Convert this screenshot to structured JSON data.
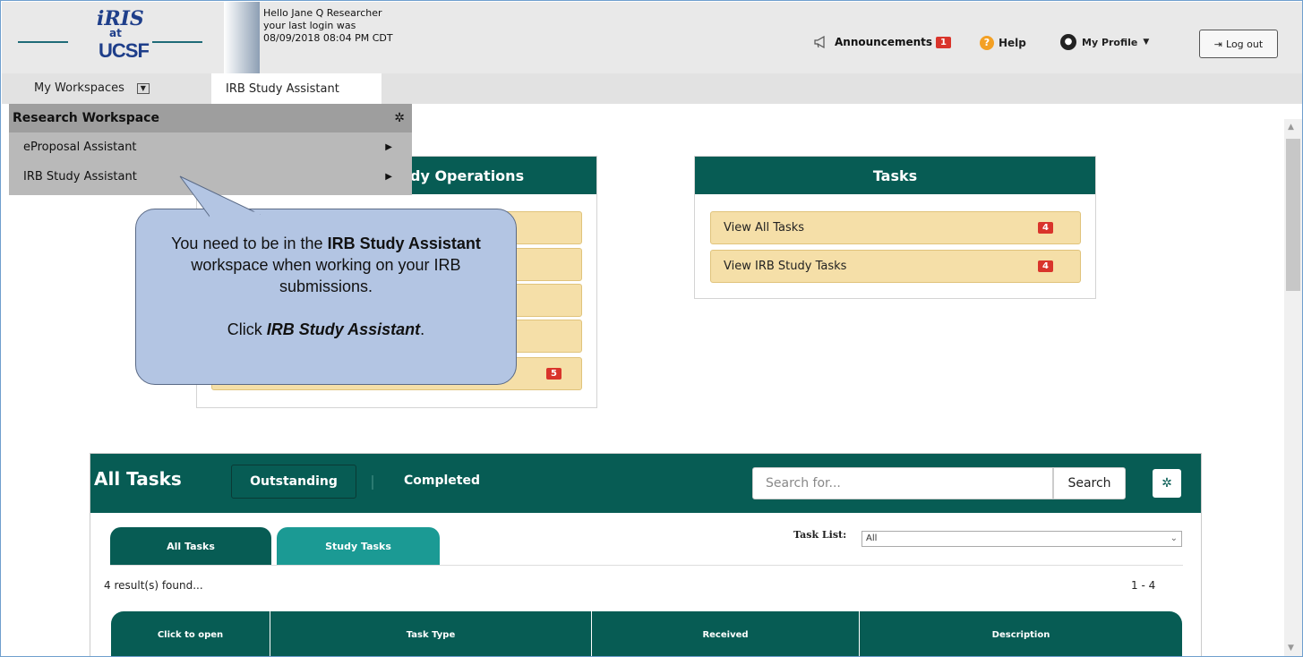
{
  "header": {
    "logo": {
      "iris": "iRIS",
      "at": "at",
      "ucsf": "UCSF"
    },
    "greeting": [
      "Hello Jane Q Researcher",
      "your last login was",
      "08/09/2018 08:04 PM CDT"
    ],
    "announcements_label": "Announcements",
    "announcements_count": "1",
    "help_label": "Help",
    "profile_label": "My Profile",
    "logout_label": "Log out"
  },
  "nav": {
    "workspaces_label": "My Workspaces",
    "active_tab": "IRB Study Assistant"
  },
  "dropdown": {
    "title": "Research Workspace",
    "items": [
      {
        "label": "eProposal Assistant"
      },
      {
        "label": "IRB Study Assistant"
      }
    ]
  },
  "study_operations": {
    "title_visible": "dy Operations",
    "badge": "5"
  },
  "tasks_panel": {
    "title": "Tasks",
    "rows": [
      {
        "label": "View All Tasks",
        "count": "4"
      },
      {
        "label": "View IRB Study Tasks",
        "count": "4"
      }
    ]
  },
  "callout": {
    "line1_pre": "You need to be in the ",
    "line1_bold": "IRB Study Assistant",
    "line1_post": " workspace when working on your IRB submissions.",
    "line2_pre": "Click ",
    "line2_bold": "IRB Study Assistant",
    "line2_post": "."
  },
  "all_tasks": {
    "title": "All Tasks",
    "outstanding_label": "Outstanding",
    "completed_label": "Completed",
    "search_placeholder": "Search for...",
    "search_button": "Search",
    "tabs": [
      "All Tasks",
      "Study Tasks"
    ],
    "task_list_label": "Task List:",
    "task_list_value": "All",
    "results_text": "4 result(s) found...",
    "paging_text": "1 - 4",
    "columns": [
      "Click to open",
      "Task Type",
      "Received",
      "Description"
    ]
  },
  "colors": {
    "brand_teal": "#075c54",
    "tab_teal_light": "#1b9a94",
    "row_yellow": "#f5dfa8",
    "badge_red": "#d9342b",
    "callout_blue": "#b3c5e3"
  }
}
